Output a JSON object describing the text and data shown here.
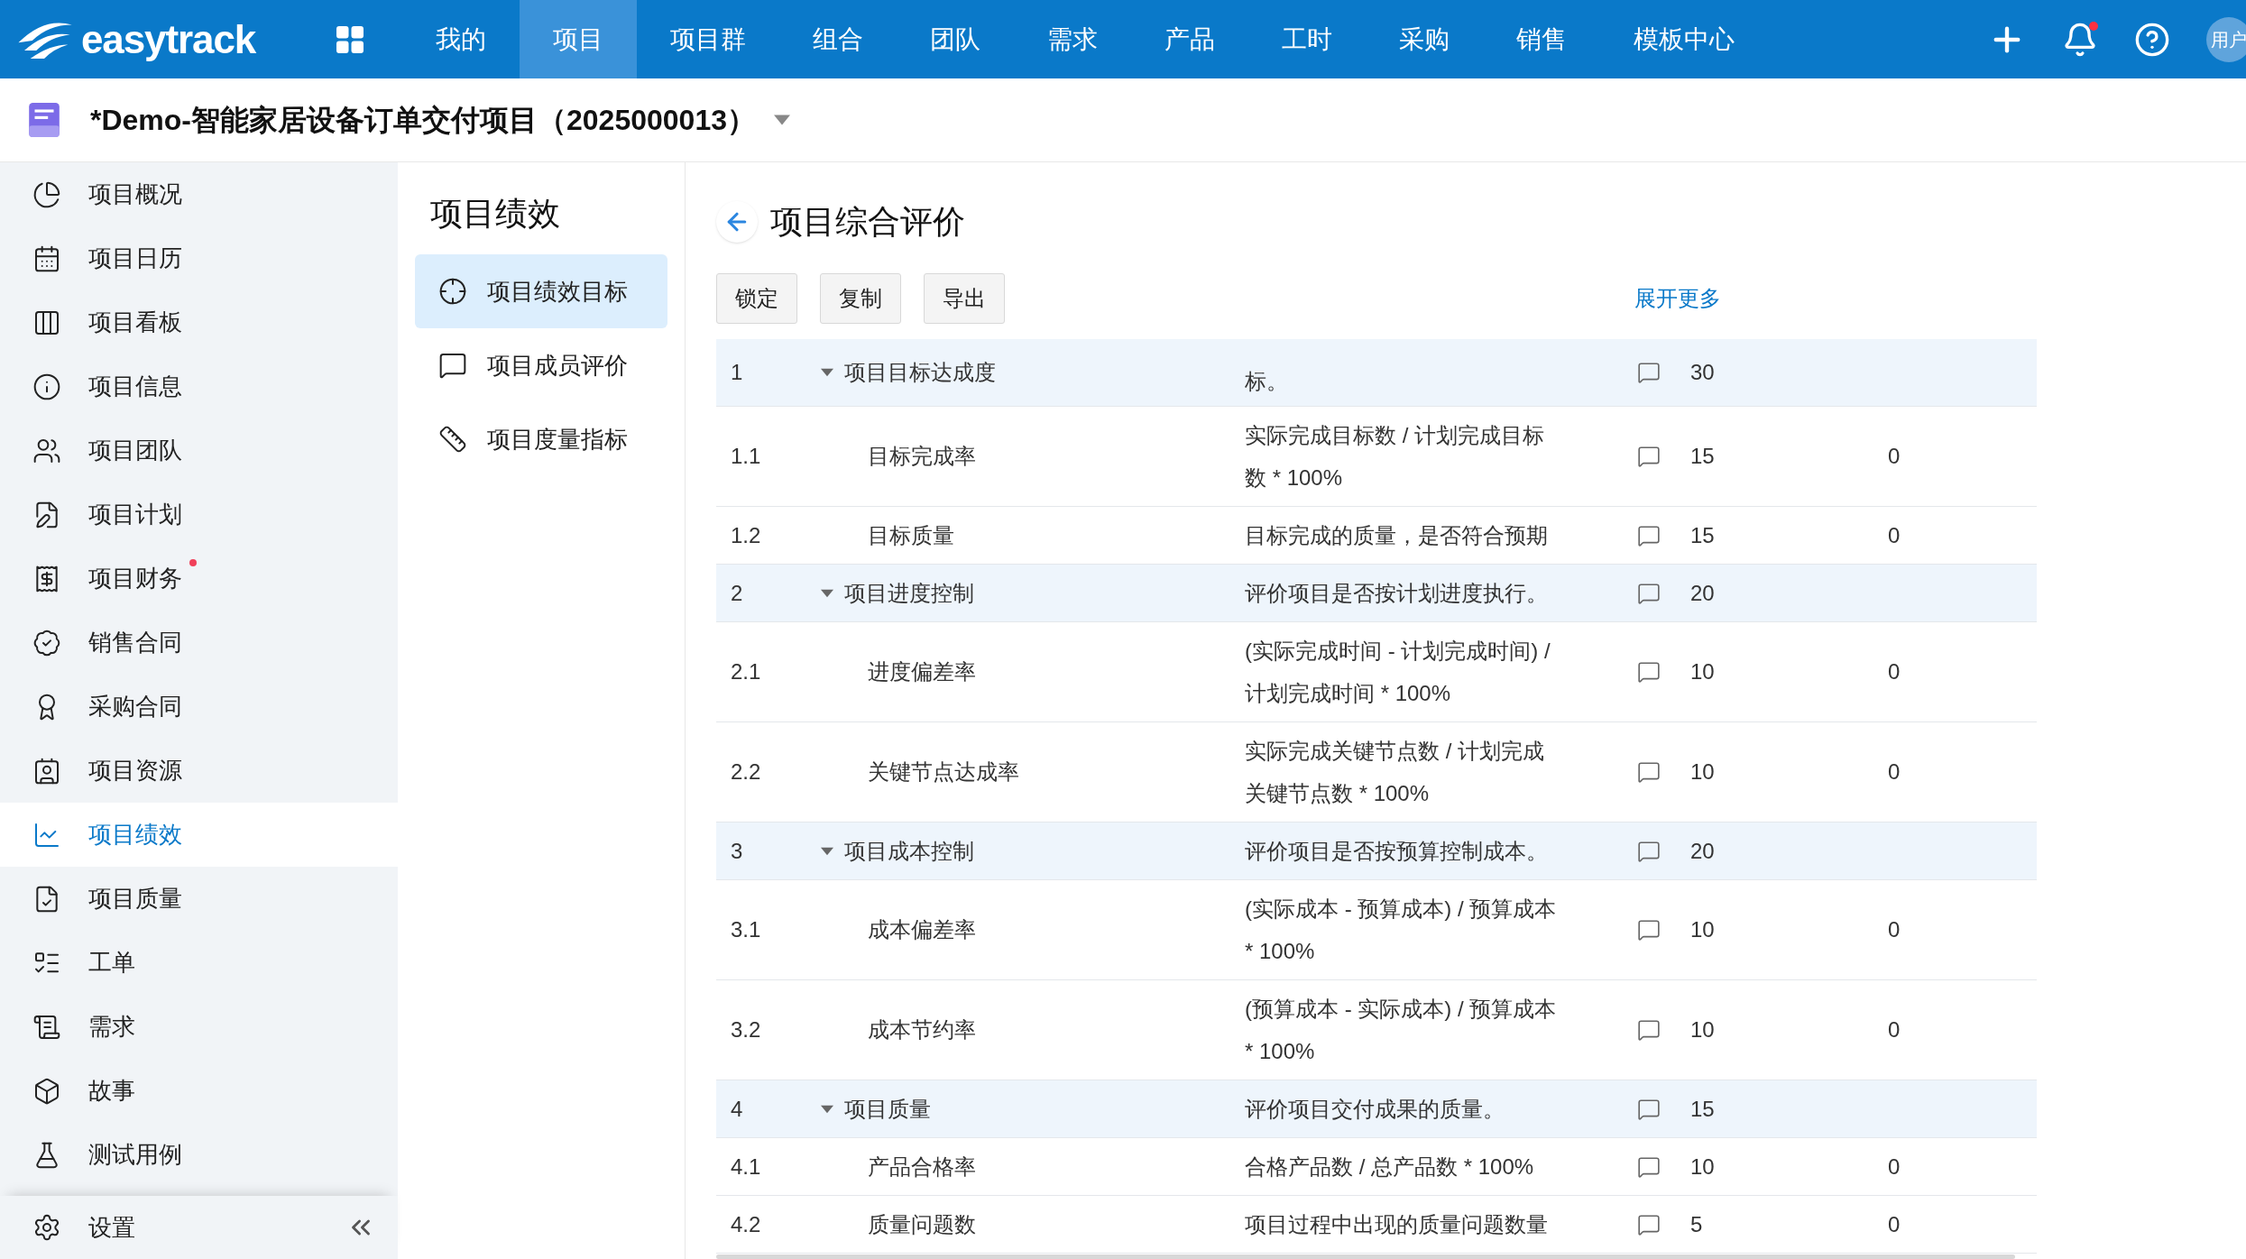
{
  "topbar": {
    "logo": "easytrack",
    "nav": [
      {
        "label": "我的",
        "selected": false
      },
      {
        "label": "项目",
        "selected": true
      },
      {
        "label": "项目群",
        "selected": false
      },
      {
        "label": "组合",
        "selected": false
      },
      {
        "label": "团队",
        "selected": false
      },
      {
        "label": "需求",
        "selected": false
      },
      {
        "label": "产品",
        "selected": false
      },
      {
        "label": "工时",
        "selected": false
      },
      {
        "label": "采购",
        "selected": false
      },
      {
        "label": "销售",
        "selected": false
      },
      {
        "label": "模板中心",
        "selected": false
      }
    ],
    "notification_dot": true,
    "avatar": "用户"
  },
  "project": {
    "title": "*Demo-智能家居设备订单交付项目（2025000013）"
  },
  "sidebar": {
    "items": [
      {
        "label": "项目概况",
        "selected": false,
        "dot": false
      },
      {
        "label": "项目日历",
        "selected": false,
        "dot": false
      },
      {
        "label": "项目看板",
        "selected": false,
        "dot": false
      },
      {
        "label": "项目信息",
        "selected": false,
        "dot": false
      },
      {
        "label": "项目团队",
        "selected": false,
        "dot": false
      },
      {
        "label": "项目计划",
        "selected": false,
        "dot": false
      },
      {
        "label": "项目财务",
        "selected": false,
        "dot": true
      },
      {
        "label": "销售合同",
        "selected": false,
        "dot": false
      },
      {
        "label": "采购合同",
        "selected": false,
        "dot": false
      },
      {
        "label": "项目资源",
        "selected": false,
        "dot": false
      },
      {
        "label": "项目绩效",
        "selected": true,
        "dot": false
      },
      {
        "label": "项目质量",
        "selected": false,
        "dot": false
      },
      {
        "label": "工单",
        "selected": false,
        "dot": false
      },
      {
        "label": "需求",
        "selected": false,
        "dot": false
      },
      {
        "label": "故事",
        "selected": false,
        "dot": false
      },
      {
        "label": "测试用例",
        "selected": false,
        "dot": false
      }
    ],
    "settings": "设置"
  },
  "subnav": {
    "title": "项目绩效",
    "items": [
      {
        "label": "项目绩效目标",
        "selected": true
      },
      {
        "label": "项目成员评价",
        "selected": false
      },
      {
        "label": "项目度量指标",
        "selected": false
      }
    ]
  },
  "main": {
    "title": "项目综合评价",
    "buttons": [
      "锁定",
      "复制",
      "导出"
    ],
    "expand_link": "展开更多",
    "rows": [
      {
        "kind": "group",
        "no": "1",
        "name": "项目目标达成度",
        "description": "标。",
        "score": "30",
        "expanded": true
      },
      {
        "kind": "item",
        "no": "1.1",
        "name": "目标完成率",
        "description": "实际完成目标数 / 计划完成目标数 * 100%",
        "score": "15",
        "column_5": "0"
      },
      {
        "kind": "item",
        "no": "1.2",
        "name": "目标质量",
        "description": "目标完成的质量，是否符合预期",
        "score": "15",
        "column_5": "0"
      },
      {
        "kind": "group",
        "no": "2",
        "name": "项目进度控制",
        "description": "评价项目是否按计划进度执行。",
        "score": "20",
        "expanded": true
      },
      {
        "kind": "item",
        "no": "2.1",
        "name": "进度偏差率",
        "description": "(实际完成时间 - 计划完成时间) / 计划完成时间 * 100%",
        "score": "10",
        "column_5": "0"
      },
      {
        "kind": "item",
        "no": "2.2",
        "name": "关键节点达成率",
        "description": "实际完成关键节点数 / 计划完成关键节点数 * 100%",
        "score": "10",
        "column_5": "0"
      },
      {
        "kind": "group",
        "no": "3",
        "name": "项目成本控制",
        "description": "评价项目是否按预算控制成本。",
        "score": "20",
        "expanded": true
      },
      {
        "kind": "item",
        "no": "3.1",
        "name": "成本偏差率",
        "description": "(实际成本 - 预算成本) / 预算成本 * 100%",
        "score": "10",
        "column_5": "0"
      },
      {
        "kind": "item",
        "no": "3.2",
        "name": "成本节约率",
        "description": "(预算成本 - 实际成本) / 预算成本 * 100%",
        "score": "10",
        "column_5": "0"
      },
      {
        "kind": "group",
        "no": "4",
        "name": "项目质量",
        "description": "评价项目交付成果的质量。",
        "score": "15",
        "expanded": true
      },
      {
        "kind": "item",
        "no": "4.1",
        "name": "产品合格率",
        "description": "合格产品数 / 总产品数 * 100%",
        "score": "10",
        "column_5": "0"
      },
      {
        "kind": "item",
        "no": "4.2",
        "name": "质量问题数",
        "description": "项目过程中出现的质量问题数量",
        "score": "5",
        "column_5": "0"
      }
    ]
  }
}
